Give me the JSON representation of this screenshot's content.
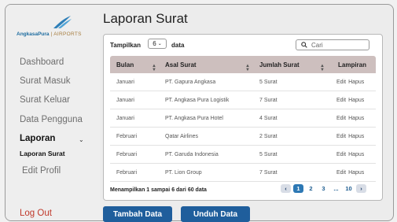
{
  "logo": {
    "brand": "AngkasaPura",
    "separator": "|",
    "sub": "AIRPORTS"
  },
  "sidebar": {
    "items": [
      {
        "label": "Dashboard"
      },
      {
        "label": "Surat Masuk"
      },
      {
        "label": "Surat Keluar"
      },
      {
        "label": "Data Pengguna"
      },
      {
        "label": "Laporan"
      },
      {
        "label": "Laporan Surat"
      },
      {
        "label": "Edit Profil"
      }
    ],
    "logout": "Log Out"
  },
  "main": {
    "title": "Laporan Surat",
    "length_label": "Tampilkan",
    "length_value": "6",
    "length_suffix": "data",
    "search_placeholder": "Cari",
    "columns": [
      "Bulan",
      "Asal Surat",
      "Jumlah Surat",
      "Lampiran"
    ],
    "rows": [
      {
        "bulan": "Januari",
        "asal": "PT. Gapura Angkasa",
        "jumlah": "5 Surat",
        "edit": "Edit",
        "hapus": "Hapus"
      },
      {
        "bulan": "Januari",
        "asal": "PT. Angkasa Pura Logistik",
        "jumlah": "7 Surat",
        "edit": "Edit",
        "hapus": "Hapus"
      },
      {
        "bulan": "Januari",
        "asal": "PT. Angkasa Pura Hotel",
        "jumlah": "4 Surat",
        "edit": "Edit",
        "hapus": "Hapus"
      },
      {
        "bulan": "Februari",
        "asal": "Qatar Airlines",
        "jumlah": "2 Surat",
        "edit": "Edit",
        "hapus": "Hapus"
      },
      {
        "bulan": "Februari",
        "asal": "PT. Garuda Indonesia",
        "jumlah": "5 Surat",
        "edit": "Edit",
        "hapus": "Hapus"
      },
      {
        "bulan": "Februari",
        "asal": "PT. Lion Group",
        "jumlah": "7 Surat",
        "edit": "Edit",
        "hapus": "Hapus"
      }
    ],
    "info": "Menampilkan 1 sampai 6 dari 60 data",
    "pagination": {
      "prev": "‹",
      "pages": [
        "1",
        "2",
        "3",
        "...",
        "10"
      ],
      "current": "1",
      "next": "›"
    },
    "add_button": "Tambah Data",
    "download_button": "Unduh Data"
  },
  "colors": {
    "primary": "#1f5e9c",
    "header_bg": "#cdbfbe",
    "logout": "#c0392b"
  }
}
